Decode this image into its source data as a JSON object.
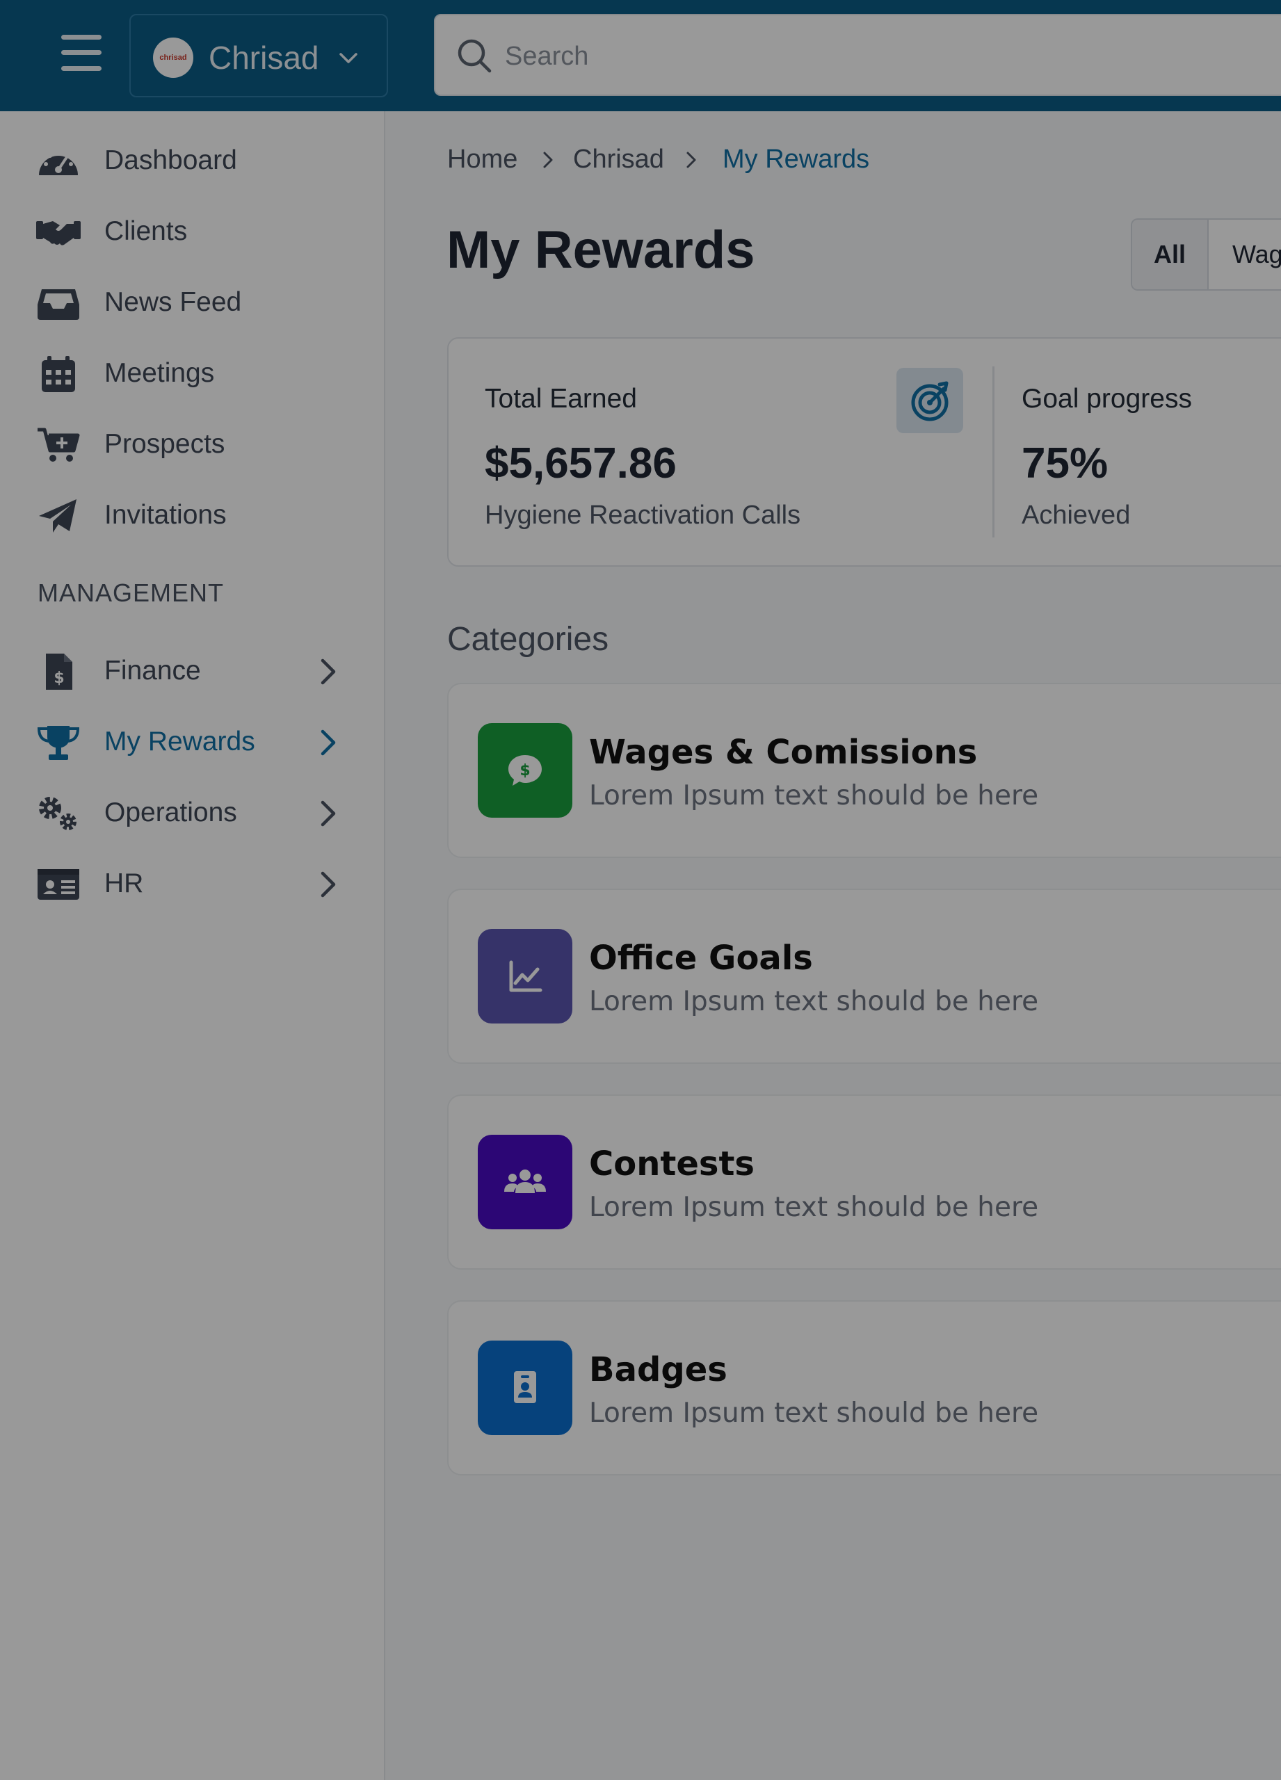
{
  "header": {
    "org_name": "Chrisad",
    "org_logo_text": "chrisad",
    "search_placeholder": "Search"
  },
  "sidebar": {
    "items": [
      {
        "label": "Dashboard",
        "icon": "dashboard-gauge-icon"
      },
      {
        "label": "Clients",
        "icon": "handshake-icon"
      },
      {
        "label": "News Feed",
        "icon": "inbox-tray-icon"
      },
      {
        "label": "Meetings",
        "icon": "calendar-icon"
      },
      {
        "label": "Prospects",
        "icon": "cart-plus-icon"
      },
      {
        "label": "Invitations",
        "icon": "paper-plane-icon"
      }
    ],
    "section_label": "MANAGEMENT",
    "management_items": [
      {
        "label": "Finance",
        "icon": "invoice-dollar-icon"
      },
      {
        "label": "My Rewards",
        "icon": "trophy-icon",
        "active": true
      },
      {
        "label": "Operations",
        "icon": "cogs-icon"
      },
      {
        "label": "HR",
        "icon": "id-card-icon"
      }
    ]
  },
  "breadcrumb": [
    "Home",
    "Chrisad",
    "My Rewards"
  ],
  "page": {
    "title": "My Rewards",
    "filters": [
      "All",
      "Wag"
    ]
  },
  "stats": {
    "total": {
      "title": "Total Earned",
      "value": "$5,657.86",
      "subtitle": "Hygiene Reactivation Calls",
      "icon": "target-arrow-icon"
    },
    "goal": {
      "title": "Goal progress",
      "value": "75%",
      "subtitle": "Achieved"
    }
  },
  "categories": {
    "label": "Categories",
    "items": [
      {
        "title": "Wages & Comissions",
        "description": "Lorem Ipsum text should be here",
        "color": "#1a9e3f",
        "icon": "money-chat-icon"
      },
      {
        "title": "Office Goals",
        "description": "Lorem Ipsum text should be here",
        "color": "#5a56b0",
        "icon": "line-chart-icon"
      },
      {
        "title": "Contests",
        "description": "Lorem Ipsum text should be here",
        "color": "#4a0bc4",
        "icon": "users-group-icon"
      },
      {
        "title": "Badges",
        "description": "Lorem Ipsum text should be here",
        "color": "#0b6ecf",
        "icon": "badge-id-icon"
      }
    ]
  },
  "colors": {
    "topbar": "#0b5c86",
    "accent": "#0f6fa3",
    "overlay": "rgba(0,0,0,0.40)"
  }
}
